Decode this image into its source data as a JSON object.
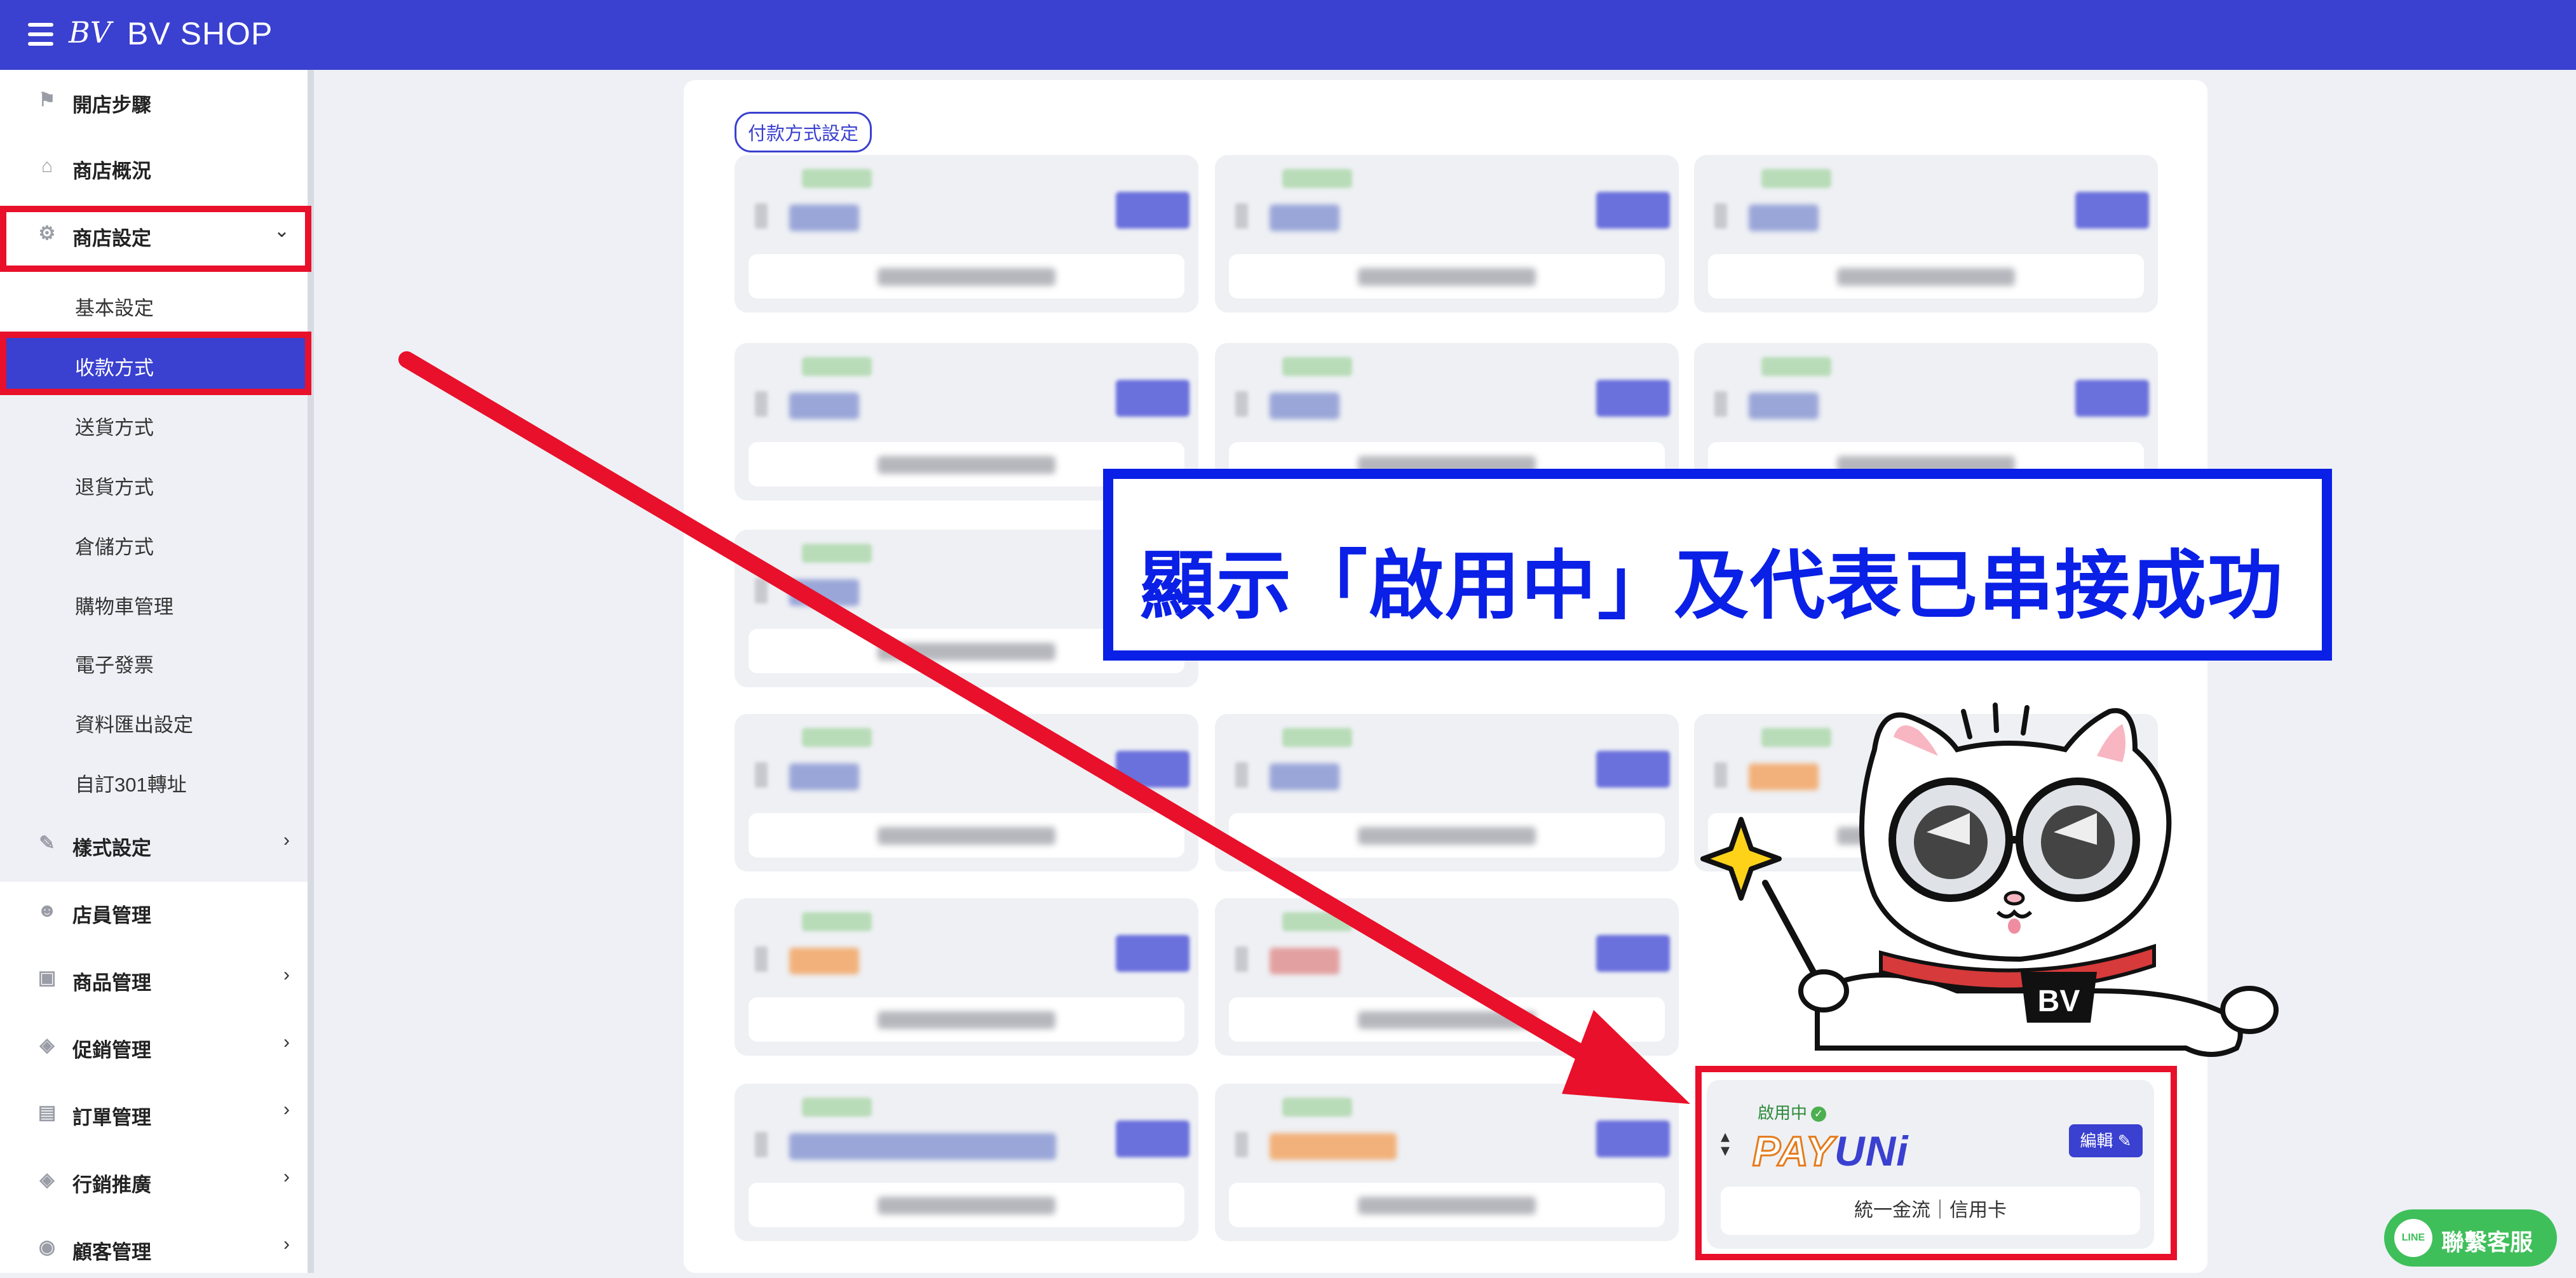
{
  "header": {
    "brand": "BV SHOP",
    "logo_text": "BV"
  },
  "sidebar": {
    "items": [
      {
        "label": "開店步驟",
        "icon": "flag-icon"
      },
      {
        "label": "商店概況",
        "icon": "home-icon"
      },
      {
        "label": "商店設定",
        "icon": "gear-icon",
        "expanded": true
      },
      {
        "label": "樣式設定",
        "icon": "wand-icon"
      },
      {
        "label": "店員管理",
        "icon": "users-icon"
      },
      {
        "label": "商品管理",
        "icon": "box-icon"
      },
      {
        "label": "促銷管理",
        "icon": "tag-icon"
      },
      {
        "label": "訂單管理",
        "icon": "clipboard-icon"
      },
      {
        "label": "行銷推廣",
        "icon": "tag-icon"
      },
      {
        "label": "顧客管理",
        "icon": "user-icon"
      }
    ],
    "sub_items": [
      {
        "label": "基本設定"
      },
      {
        "label": "收款方式",
        "active": true
      },
      {
        "label": "送貨方式"
      },
      {
        "label": "退貨方式"
      },
      {
        "label": "倉儲方式"
      },
      {
        "label": "購物車管理"
      },
      {
        "label": "電子發票"
      },
      {
        "label": "資料匯出設定"
      },
      {
        "label": "自訂301轉址"
      }
    ]
  },
  "main": {
    "section_tag": "付款方式設定",
    "payuni": {
      "status": "啟用中",
      "logo_pay": "PAY",
      "logo_uni": "UNi",
      "edit_label": "編輯",
      "bottom_label": "統一金流｜信用卡"
    }
  },
  "annotation": {
    "text": "顯示「啟用中」及代表已串接成功"
  },
  "mascot": {
    "badge": "BV"
  },
  "support": {
    "label": "聯繫客服",
    "icon_text": "LINE"
  },
  "colors": {
    "brand": "#3a40cf",
    "highlight_red": "#e8102a",
    "annotation_blue": "#0a20e6",
    "line_green": "#3fbf5a"
  }
}
